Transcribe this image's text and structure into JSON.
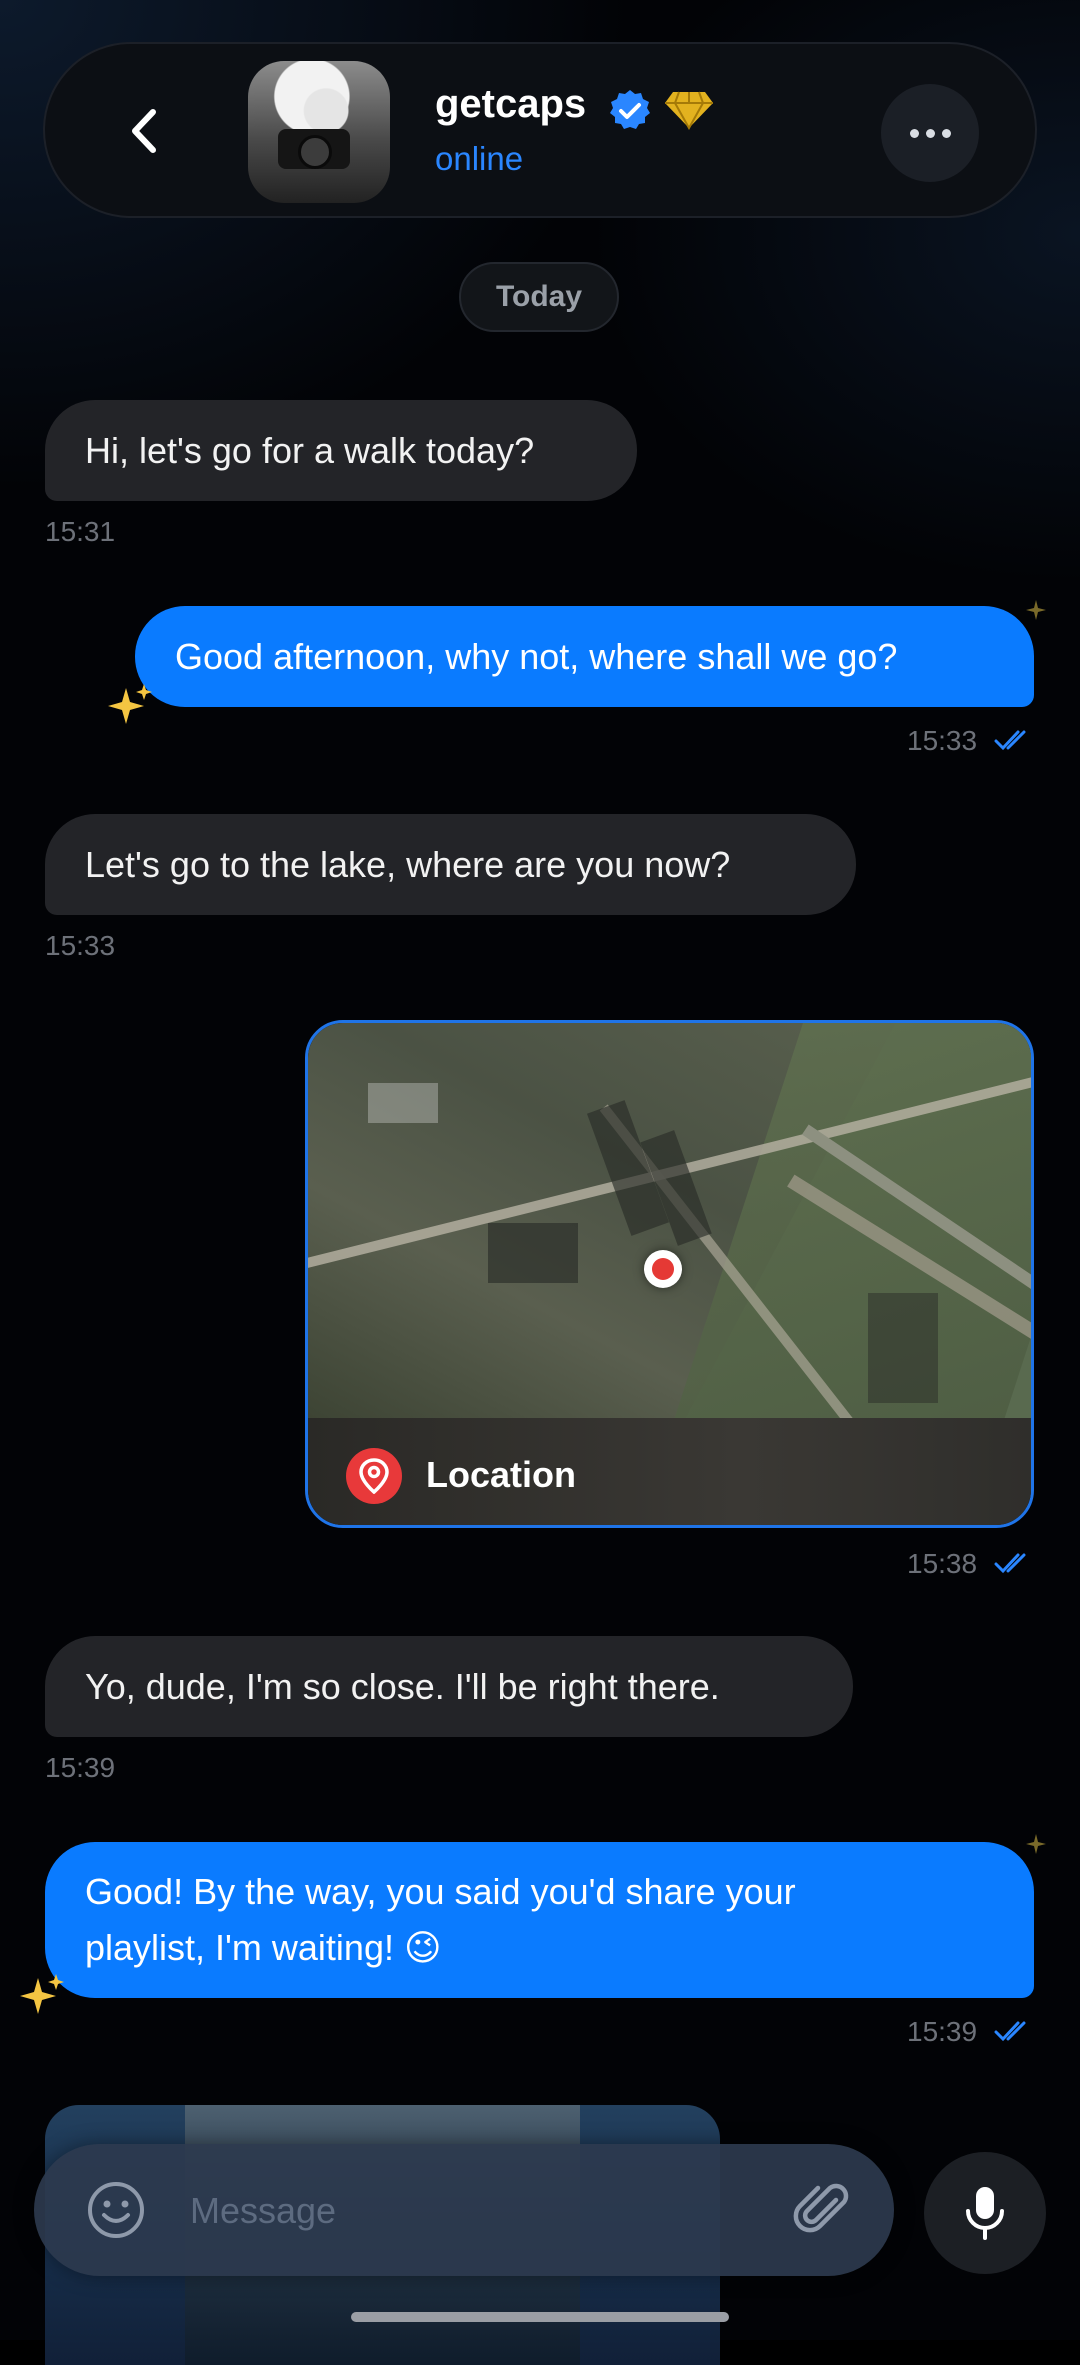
{
  "header": {
    "contact_name": "getcaps",
    "status": "online",
    "back_icon": "chevron-left-icon",
    "verified_icon": "verified-badge-icon",
    "premium_icon": "diamond-icon",
    "more_icon": "ellipsis-icon"
  },
  "date_separator": "Today",
  "messages": [
    {
      "direction": "in",
      "text": "Hi, let's go for a walk today?",
      "time": "15:31"
    },
    {
      "direction": "out",
      "text": "Good afternoon, why not, where shall we go?",
      "time": "15:33",
      "read": true
    },
    {
      "direction": "in",
      "text": "Let's go to the lake, where are you now?",
      "time": "15:33"
    },
    {
      "direction": "out",
      "type": "location",
      "label": "Location",
      "time": "15:38",
      "read": true
    },
    {
      "direction": "in",
      "text": "Yo, dude, I'm so close. I'll be right there.",
      "time": "15:39"
    },
    {
      "direction": "out",
      "text_line1": "Good! By the way, you said you'd share your",
      "text_line2": "playlist, I'm waiting! 😉",
      "time": "15:39",
      "read": true
    }
  ],
  "composer": {
    "placeholder": "Message",
    "emoji_icon": "emoji-icon",
    "attach_icon": "paperclip-icon",
    "mic_icon": "microphone-icon"
  },
  "colors": {
    "accent": "#0a7bff",
    "incoming_bubble": "#232428",
    "online": "#2a86ff",
    "location_pin": "#e8393a"
  }
}
